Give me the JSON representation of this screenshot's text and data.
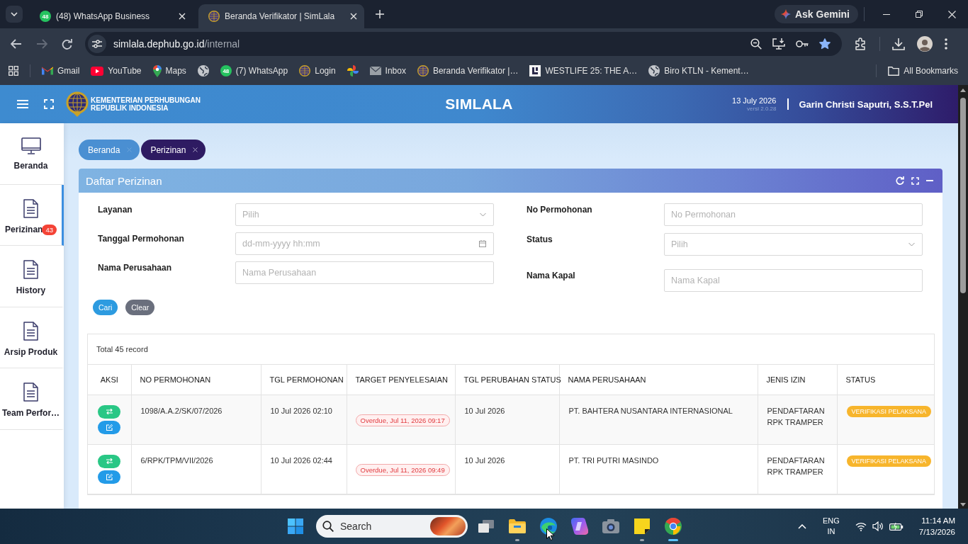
{
  "browser": {
    "tabs": [
      {
        "title": "(48) WhatsApp Business",
        "kind": "whatsapp",
        "favicon_badge": "48",
        "selected": false
      },
      {
        "title": "Beranda Verifikator | SimLala",
        "kind": "emblem",
        "selected": true
      }
    ],
    "ask_gemini": "Ask Gemini",
    "nav_buttons": [
      {
        "kind": "back",
        "disabled": false
      },
      {
        "kind": "forward",
        "disabled": true
      },
      {
        "kind": "reload",
        "disabled": false
      }
    ],
    "url_host": "simlala.dephub.go.id",
    "url_path": "/internal",
    "page_bookmarked": true,
    "bookmarks": [
      {
        "kind": "gmail",
        "label": "Gmail"
      },
      {
        "kind": "youtube",
        "label": "YouTube"
      },
      {
        "kind": "maps",
        "label": "Maps"
      },
      {
        "kind": "globe"
      },
      {
        "kind": "whatsapp",
        "label": "(7) WhatsApp",
        "icon_badge": "48"
      },
      {
        "kind": "emblem",
        "label": "Login"
      },
      {
        "kind": "pinwheel"
      },
      {
        "kind": "mail",
        "label": "Inbox"
      },
      {
        "kind": "emblem",
        "label": "Beranda Verifikator |…"
      },
      {
        "kind": "letter-square",
        "label": "WESTLIFE 25: THE A…"
      },
      {
        "kind": "globe",
        "label": "Biro KTLN - Kement…"
      }
    ],
    "all_bookmarks": "All Bookmarks"
  },
  "header": {
    "org_name": [
      "KEMENTERIAN PERHUBUNGAN",
      "REPUBLIK INDONESIA"
    ],
    "title": "SIMLALA",
    "date": "13 July 2026",
    "version": "versi 2.0.28",
    "user": "Garin Christi Saputri, S.S.T.Pel"
  },
  "sidebar": {
    "items": [
      {
        "kind": "monitor",
        "label": "Beranda",
        "selected": false
      },
      {
        "kind": "document",
        "label": "Perizinan",
        "badge": "43",
        "selected": true
      },
      {
        "kind": "document",
        "label": "History",
        "selected": false
      },
      {
        "kind": "document",
        "label": "Arsip Produk",
        "selected": false
      },
      {
        "kind": "document",
        "label": "Team Perfor…",
        "selected": false
      }
    ]
  },
  "page_tabs": [
    {
      "label": "Beranda",
      "selected": false
    },
    {
      "label": "Perizinan",
      "selected": true
    }
  ],
  "panel": {
    "title": "Daftar Perizinan",
    "filters_left": [
      {
        "kind": "select",
        "label": "Layanan",
        "placeholder": "Pilih"
      },
      {
        "kind": "date",
        "label": "Tanggal Permohonan",
        "placeholder": "dd-mm-yyyy hh:mm"
      },
      {
        "kind": "text",
        "label": "Nama Perusahaan",
        "placeholder": "Nama Perusahaan"
      }
    ],
    "filters_right": [
      {
        "kind": "text",
        "label": "No Permohonan",
        "placeholder": "No Permohonan"
      },
      {
        "kind": "select",
        "label": "Status",
        "placeholder": "Pilih"
      },
      {
        "kind": "text",
        "label": "Nama Kapal",
        "placeholder": "Nama Kapal"
      }
    ],
    "buttons": [
      {
        "kind": "primary",
        "label": "Cari"
      },
      {
        "kind": "secondary",
        "label": "Clear"
      }
    ]
  },
  "table": {
    "total": "Total 45 record",
    "columns": [
      "AKSI",
      "NO PERMOHONAN",
      "TGL PERMOHONAN",
      "TARGET PENYELESAIAN",
      "TGL PERUBAHAN STATUS",
      "NAMA PERUSAHAAN",
      "JENIS IZIN",
      "STATUS"
    ],
    "rows": [
      {
        "no_permohonan": "1098/A.A.2/SK/07/2026",
        "tgl_permohonan": "10 Jul 2026 02:10",
        "target": "Overdue, Jul 11, 2026 09:17",
        "tgl_status": "10 Jul 2026",
        "perusahaan": "PT. BAHTERA NUSANTARA INTERNASIONAL",
        "jenis_izin": "PENDAFTARAN RPK TRAMPER",
        "status": "VERIFIKASI PELAKSANA"
      },
      {
        "no_permohonan": "6/RPK/TPM/VII/2026",
        "tgl_permohonan": "10 Jul 2026 02:44",
        "target": "Overdue, Jul 11, 2026 09:49",
        "tgl_status": "10 Jul 2026",
        "perusahaan": "PT. TRI PUTRI MASINDO",
        "jenis_izin": "PENDAFTARAN RPK TRAMPER",
        "status": "VERIFIKASI PELAKSANA"
      }
    ]
  },
  "taskbar": {
    "search_placeholder": "Search",
    "apps": [
      {
        "kind": "task-view",
        "running": false,
        "selected": false
      },
      {
        "kind": "folder",
        "running": true,
        "selected": false
      },
      {
        "kind": "wave-browser",
        "running": false,
        "selected": false
      },
      {
        "kind": "swirl",
        "running": false,
        "selected": false
      },
      {
        "kind": "camera",
        "running": false,
        "selected": false
      },
      {
        "kind": "sticky-note",
        "running": true,
        "selected": false
      },
      {
        "kind": "round-browser",
        "running": true,
        "selected": true
      }
    ],
    "language": [
      "ENG",
      "IN"
    ],
    "time": "11:14 AM",
    "date": "7/13/2026"
  }
}
